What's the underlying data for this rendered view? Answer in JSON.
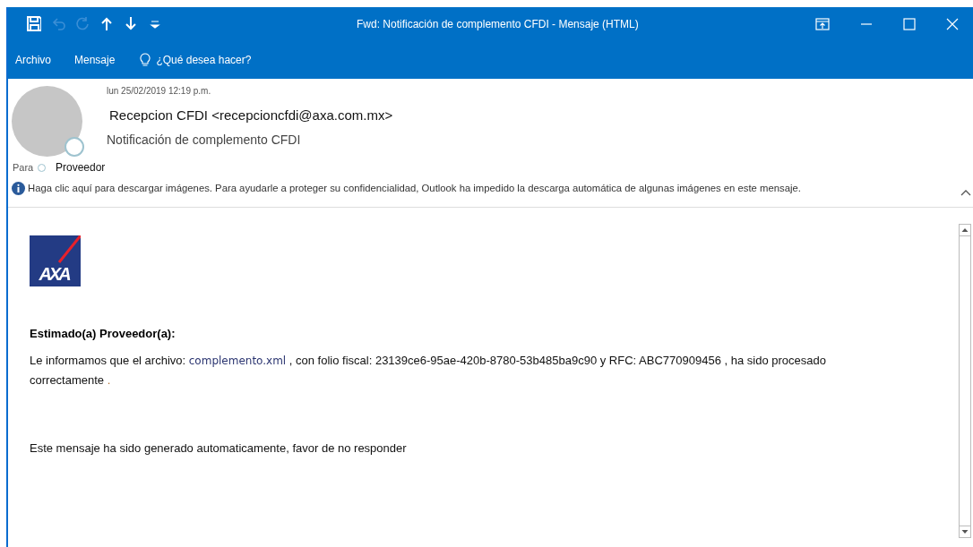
{
  "window": {
    "title": "Fwd: Notificación de complemento CFDI  -  Mensaje (HTML)"
  },
  "quick_access": [
    {
      "kind": "save",
      "disabled": false
    },
    {
      "kind": "undo",
      "disabled": true
    },
    {
      "kind": "redo",
      "disabled": true
    },
    {
      "kind": "up",
      "disabled": false
    },
    {
      "kind": "down",
      "disabled": false
    },
    {
      "kind": "customize",
      "disabled": false
    }
  ],
  "menu": [
    {
      "kind": "item",
      "label": "Archivo"
    },
    {
      "kind": "item",
      "label": "Mensaje"
    },
    {
      "kind": "search",
      "label": "¿Qué desea hacer?"
    }
  ],
  "header": {
    "date": "lun 25/02/2019 12:19 p.m.",
    "from": "Recepcion CFDI <recepcioncfdi@axa.com.mx>",
    "subject": "Notificación de complemento CFDI",
    "to_label": "Para",
    "to": "Proveedor",
    "info": "Haga clic aquí para descargar imágenes. Para ayudarle a proteger su confidencialidad, Outlook ha impedido la descarga automática de algunas imágenes en este mensaje."
  },
  "body": {
    "logo": "AXA",
    "greeting": "Estimado(a) Proveedor(a):",
    "paragraph": [
      {
        "kind": "plain",
        "text": "Le informamos que el archivo: "
      },
      {
        "kind": "file",
        "text": "complemento.xml"
      },
      {
        "kind": "plain",
        "text": " , con folio fiscal: 23139ce6-95ae-420b-8780-53b485ba9c90 y RFC:  "
      },
      {
        "kind": "rfc",
        "text": "ABC770909456"
      },
      {
        "kind": "plain",
        "text": " , ha sido procesado correctamente "
      },
      {
        "kind": "dot",
        "text": "."
      }
    ],
    "footer": "Este mensaje ha sido generado automaticamente, favor de no responder"
  }
}
